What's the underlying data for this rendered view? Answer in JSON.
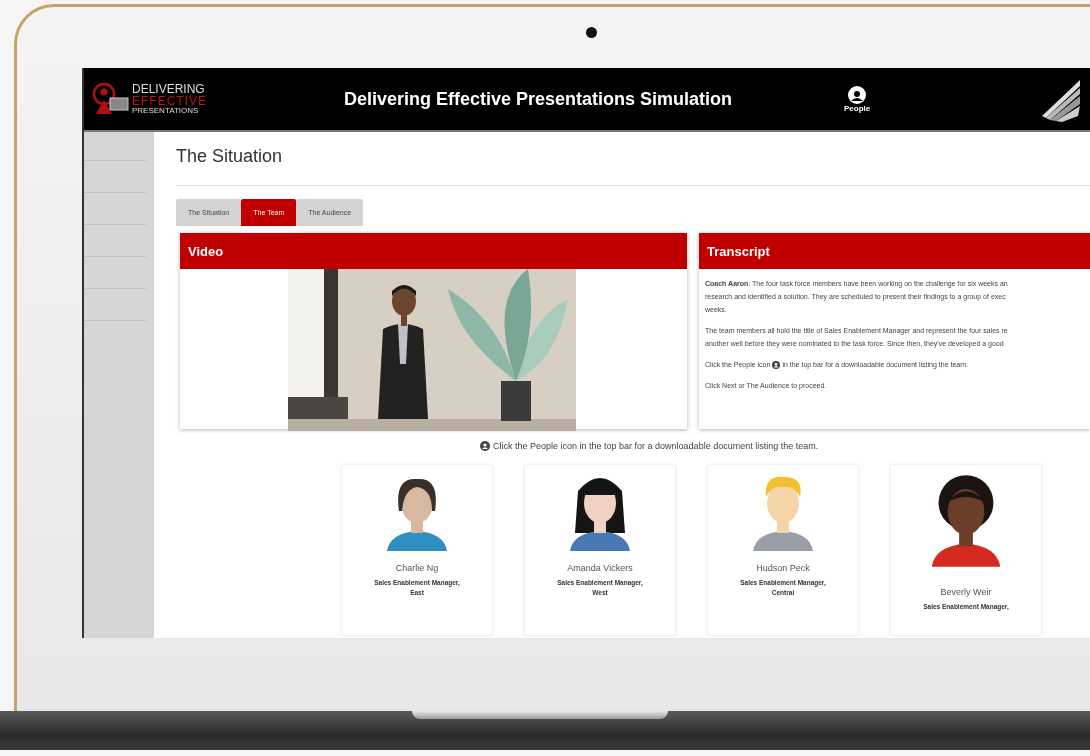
{
  "header": {
    "logo_lines": [
      "DELIVERING",
      "EFFECTIVE",
      "PRESENTATIONS"
    ],
    "title": "Delivering Effective Presentations Simulation",
    "people_button": "People"
  },
  "page_title": "The Situation",
  "tabs": [
    {
      "label": "The Situation",
      "selected": false
    },
    {
      "label": "The Team",
      "selected": true
    },
    {
      "label": "The Audience",
      "selected": false
    }
  ],
  "video_panel": {
    "title": "Video"
  },
  "transcript_panel": {
    "title": "Transcript",
    "paragraphs": [
      {
        "kind": "text",
        "lines": [
          "**Coach Aaron**: The four task force members have been working on the challenge for six weeks an",
          "research and identified a solution. They are scheduled to present their findings to a group of exec",
          "weeks."
        ]
      },
      {
        "kind": "text",
        "lines": [
          "The team members all hold the title of Sales Enablement Manager and represent the four sales re",
          "another well before they were nominated to the task force. Since then, they've developed a good"
        ]
      },
      {
        "kind": "icon_text",
        "before": "Click the People icon",
        "after": "in the top bar for a downloadable document listing the team."
      },
      {
        "kind": "text",
        "lines": [
          "Click Next or The Audience to proceed."
        ]
      }
    ]
  },
  "caption": "Click the People icon in the top bar for a downloadable document listing the team.",
  "team": [
    {
      "name": "Charlie Ng",
      "title_lines": [
        "Sales Enablement Manager,",
        "East"
      ]
    },
    {
      "name": "Amanda Vickers",
      "title_lines": [
        "Sales Enablement Manager,",
        "West"
      ]
    },
    {
      "name": "Hudson Peck",
      "title_lines": [
        "Sales Enablement Manager,",
        "Central"
      ]
    },
    {
      "name": "Beverly Weir",
      "title_lines": [
        "Sales Enablement Manager,"
      ]
    }
  ]
}
